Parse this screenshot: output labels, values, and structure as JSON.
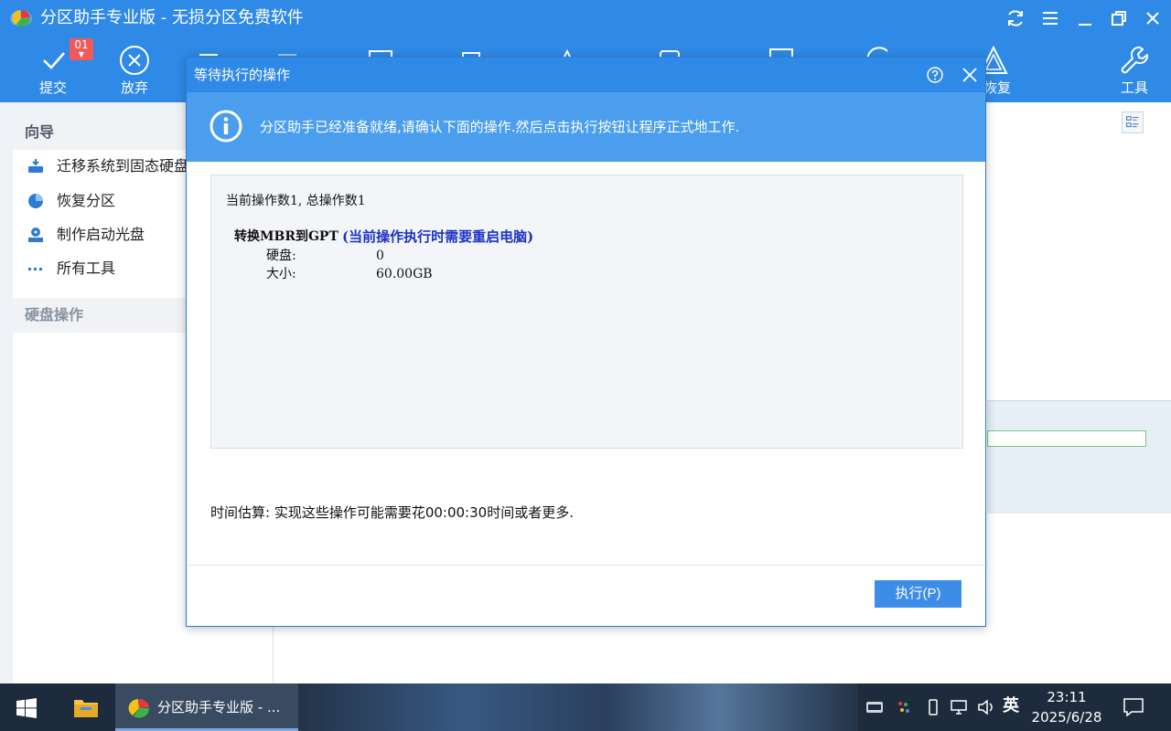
{
  "app": {
    "title": "分区助手专业版 - 无损分区免费软件",
    "pending_count_badge": "01"
  },
  "toolbar": {
    "commit_label": "提交",
    "discard_label": "放弃",
    "restore_label": "恢复",
    "tools_label": "工具"
  },
  "sidebar": {
    "wizard_header": "向导",
    "items": [
      {
        "label": "迁移系统到固态硬盘",
        "icon": "disk-migrate-icon"
      },
      {
        "label": "恢复分区",
        "icon": "pie-recover-icon"
      },
      {
        "label": "制作启动光盘",
        "icon": "bootable-disc-icon"
      },
      {
        "label": "所有工具",
        "icon": "more-dots-icon"
      }
    ],
    "disk_ops_header": "硬盘操作"
  },
  "dialog": {
    "title": "等待执行的操作",
    "banner_message": "分区助手已经准备就绪,请确认下面的操作.然后点击执行按钮让程序正式地工作.",
    "count_line": "当前操作数1, 总操作数1",
    "operation": {
      "name": "转换MBR到GPT",
      "warning": "(当前操作执行时需要重启电脑)",
      "disk_label": "硬盘:",
      "disk_value": "0",
      "size_label": "大小:",
      "size_value": "60.00GB"
    },
    "estimate": "时间估算: 实现这些操作可能需要花00:00:30时间或者更多.",
    "execute_button": "执行(P)"
  },
  "taskbar": {
    "app_button": "分区助手专业版 - ...",
    "ime": "英",
    "time": "23:11",
    "date": "2025/6/28"
  },
  "colors": {
    "accent": "#2e8ae6",
    "banner": "#4a9eed",
    "warning_text": "#1d32c8",
    "badge": "#f05a5a"
  }
}
